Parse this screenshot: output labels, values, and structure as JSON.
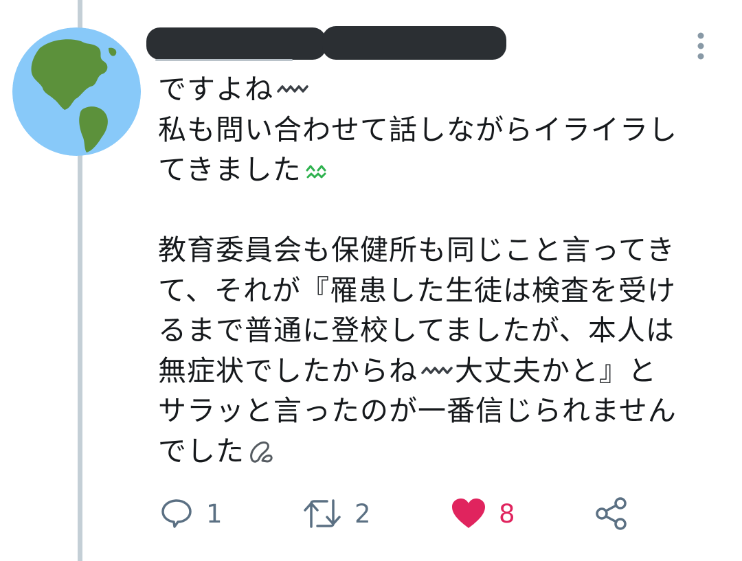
{
  "tweet": {
    "lines": [
      "ですよね",
      "私も問い合わせて話しながらイライラし",
      "てきました",
      "",
      "教育委員会も保健所も同じこと言ってき",
      "て、それが『罹患した生徒は検査を受け",
      "るまで普通に登校してましたが、本人は",
      "無症状でしたからね",
      "大丈夫かと』と",
      "サラッと言ったのが一番信じられません",
      "でした"
    ]
  },
  "actions": {
    "reply_count": "1",
    "retweet_count": "2",
    "like_count": "8"
  },
  "icons": {
    "avatar": "earth-globe-americas",
    "menu": "more-vertical-icon",
    "reply": "reply-icon",
    "retweet": "retweet-icon",
    "like": "heart-icon",
    "share": "share-icon"
  },
  "colors": {
    "like": "#e0245e",
    "action_gray": "#5b7083",
    "thread_line": "#c4cfd6"
  }
}
